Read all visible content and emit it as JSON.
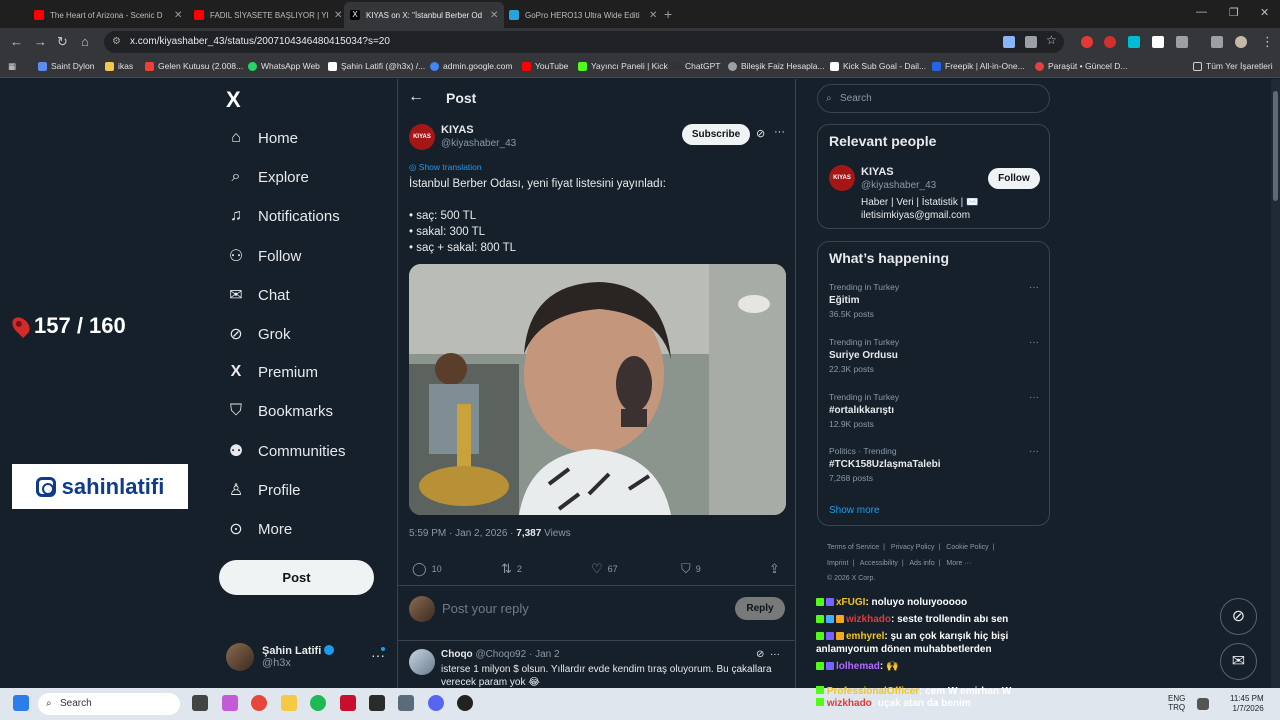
{
  "browser": {
    "tabs": [
      {
        "title": "The Heart of Arizona - Scenic D",
        "color": "#ff0000",
        "active": false
      },
      {
        "title": "FADIL SİYASETE BAŞLIYOR | YE",
        "color": "#ff0000",
        "active": false
      },
      {
        "title": "KIYAS on X: \"İstanbul Berber Od",
        "color": "#ffffff",
        "active": true
      },
      {
        "title": "GoPro HERO13 Ultra Wide Editi",
        "color": "#29a3d9",
        "active": false
      }
    ],
    "new_tab": "+",
    "url": "x.com/kiyashaber_43/status/2007104346480415034?s=20",
    "bookmarks": [
      {
        "label": "Saint Dylon",
        "color": "#5b8def"
      },
      {
        "label": "ikas",
        "color": "#f2c94c"
      },
      {
        "label": "Gelen Kutusu (2.008...",
        "color": "#ea4335"
      },
      {
        "label": "WhatsApp Web",
        "color": "#25d366"
      },
      {
        "label": "Şahin Latifi (@h3x) /...",
        "color": "#ffffff"
      },
      {
        "label": "admin.google.com",
        "color": "#4285f4"
      },
      {
        "label": "YouTube",
        "color": "#ff0000"
      },
      {
        "label": "Yayıncı Paneli | Kick",
        "color": "#53fc18"
      },
      {
        "label": "ChatGPT",
        "color": "#333333"
      },
      {
        "label": "Bileşik Faiz Hesapla...",
        "color": "#9aa0a6"
      },
      {
        "label": "Kick Sub Goal - Dail...",
        "color": "#ffffff"
      },
      {
        "label": "Freepik | All-in-One...",
        "color": "#2563eb"
      },
      {
        "label": "Paraşüt • Güncel D...",
        "color": "#e34040"
      }
    ],
    "all_bookmarks": "Tüm Yer İşaretleri"
  },
  "overlay": {
    "counter": "157 / 160",
    "instagram": "sahinlatifi"
  },
  "nav": {
    "logo": "X",
    "items": [
      {
        "label": "Home",
        "icon": "home-icon",
        "glyph": "⌂"
      },
      {
        "label": "Explore",
        "icon": "search-icon",
        "glyph": "⌕"
      },
      {
        "label": "Notifications",
        "icon": "bell-icon",
        "glyph": "🔔"
      },
      {
        "label": "Follow",
        "icon": "add-person-icon",
        "glyph": "👤"
      },
      {
        "label": "Chat",
        "icon": "mail-icon",
        "glyph": "✉"
      },
      {
        "label": "Grok",
        "icon": "grok-icon",
        "glyph": "⊘"
      },
      {
        "label": "Premium",
        "icon": "x-premium-icon",
        "glyph": "X"
      },
      {
        "label": "Bookmarks",
        "icon": "bookmark-icon",
        "glyph": "🔖"
      },
      {
        "label": "Communities",
        "icon": "communities-icon",
        "glyph": "👥"
      },
      {
        "label": "Profile",
        "icon": "profile-icon",
        "glyph": "👤"
      },
      {
        "label": "More",
        "icon": "more-circle-icon",
        "glyph": "⋯"
      }
    ],
    "post_button": "Post",
    "account": {
      "name": "Şahin Latifi",
      "handle": "@h3x"
    }
  },
  "post": {
    "header_title": "Post",
    "author_name": "KIYAS",
    "author_handle": "@kiyashaber_43",
    "avatar_text": "KIYAS",
    "subscribe": "Subscribe",
    "show_translation": "Show translation",
    "lines": [
      "İstanbul Berber Odası, yeni fiyat listesini yayınladı:",
      "",
      "• saç: 500 TL",
      "• sakal: 300 TL",
      "• saç + sakal: 800 TL"
    ],
    "timestamp": "5:59 PM · Jan 2, 2026 · ",
    "views_count": "7,387",
    "views_label": " Views",
    "actions": {
      "replies": "10",
      "reposts": "2",
      "likes": "67",
      "bookmarks": "9"
    },
    "reply_placeholder": "Post your reply",
    "reply_button": "Reply"
  },
  "comment": {
    "name": "Choqo",
    "handle_time": "@Choqo92 · Jan 2",
    "text": "isterse 1 milyon $ olsun. Yıllardır evde kendim tıraş oluyorum. Bu çakallara verecek param yok 😂"
  },
  "sidebar": {
    "search_placeholder": "Search",
    "relevant_title": "Relevant people",
    "person": {
      "name": "KIYAS",
      "handle": "@kiyashaber_43",
      "bio": "Haber | Veri | İstatistik | ✉️ iletisimkiyas@gmail.com",
      "follow": "Follow"
    },
    "happening_title": "What’s happening",
    "trends": [
      {
        "context": "Trending in Turkey",
        "name": "Eğitim",
        "posts": "36.5K posts"
      },
      {
        "context": "Trending in Turkey",
        "name": "Suriye Ordusu",
        "posts": "22.3K posts"
      },
      {
        "context": "Trending in Turkey",
        "name": "#ortalıkkarıştı",
        "posts": "12.9K posts"
      },
      {
        "context": "Politics · Trending",
        "name": "#TCK158UzlaşmaTalebi",
        "posts": "7,268 posts"
      }
    ],
    "show_more": "Show more",
    "footer": [
      "Terms of Service",
      "|",
      "Privacy Policy",
      "|",
      "Cookie Policy",
      "|",
      "Imprint",
      "|",
      "Accessibility",
      "|",
      "Ads info",
      "|",
      "More ···",
      "© 2026 X Corp."
    ]
  },
  "chat": [
    {
      "user": "xFUGI",
      "color": "#f5c518",
      "msg": ": noluyo noluıyooooo"
    },
    {
      "user": "wizkhado",
      "color": "#e23a3a",
      "msg": ": seste trollendin abı sen"
    },
    {
      "user": "emhyrel",
      "color": "#f5c518",
      "msg": ": şu an çok karışık hiç bişi anlamıyorum dönen muhabbetlerden"
    },
    {
      "user": "lolhemad",
      "color": "#b36bff",
      "msg": ": 🙌"
    }
  ],
  "chat_overlap": [
    {
      "user": "ProfessionalOfficer",
      "msg": ": cem W emirhan W"
    },
    {
      "user": "wizkhado",
      "msg": ": uçak atan da benim"
    }
  ],
  "taskbar": {
    "search": "Search",
    "lang_top": "ENG",
    "lang_bottom": "TRQ",
    "time": "11:45 PM",
    "date": "1/7/2026"
  }
}
